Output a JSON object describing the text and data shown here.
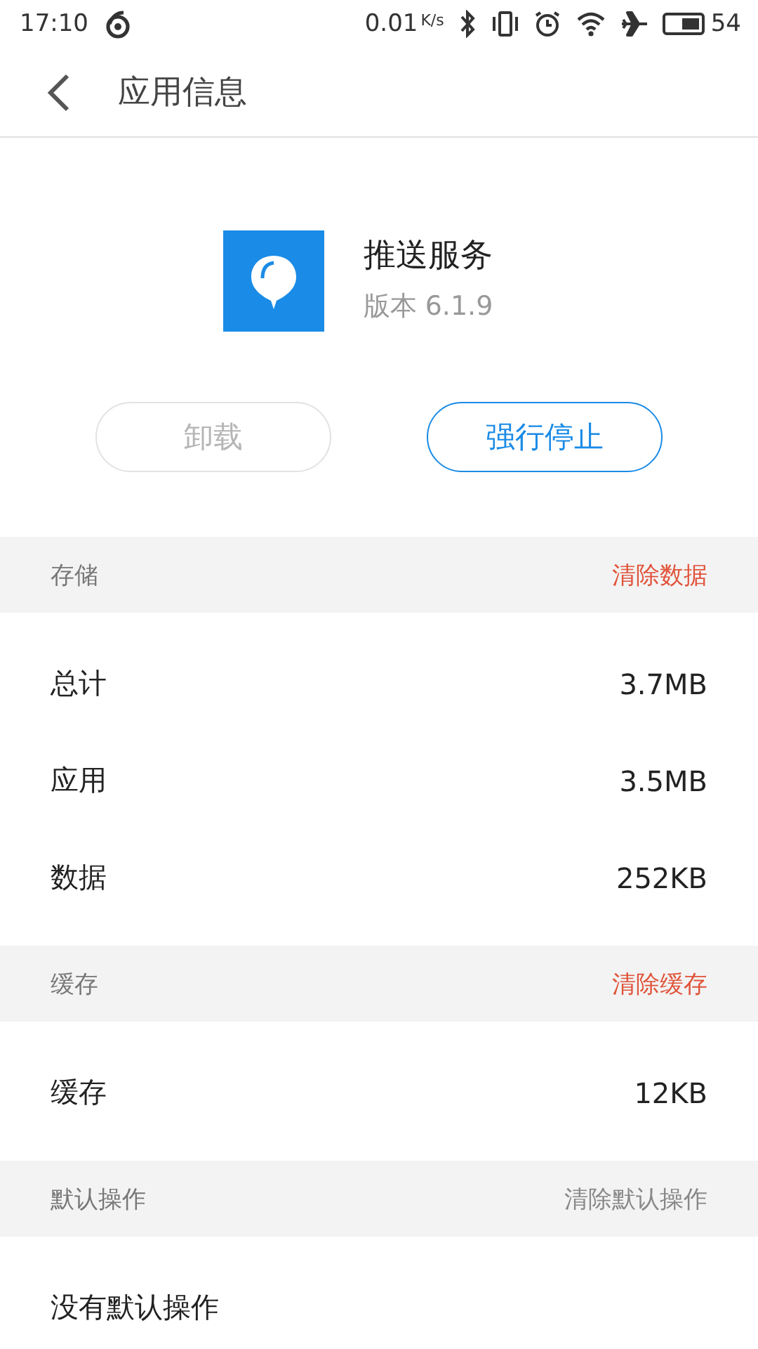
{
  "status_bar": {
    "time": "17:10",
    "speed": "0.01",
    "speed_unit": "K/s",
    "battery": "54"
  },
  "toolbar": {
    "title": "应用信息"
  },
  "app": {
    "name": "推送服务",
    "version": "版本 6.1.9"
  },
  "buttons": [
    {
      "label": "卸载",
      "disabled": true
    },
    {
      "label": "强行停止",
      "disabled": false
    }
  ],
  "sections": [
    {
      "title": "存储",
      "action": {
        "label": "清除数据",
        "disabled": false
      },
      "rows": [
        {
          "label": "总计",
          "value": "3.7MB"
        },
        {
          "label": "应用",
          "value": "3.5MB"
        },
        {
          "label": "数据",
          "value": "252KB"
        }
      ]
    },
    {
      "title": "缓存",
      "action": {
        "label": "清除缓存",
        "disabled": false
      },
      "rows": [
        {
          "label": "缓存",
          "value": "12KB"
        }
      ]
    },
    {
      "title": "默认操作",
      "action": {
        "label": "清除默认操作",
        "disabled": true
      },
      "rows": [
        {
          "label": "没有默认操作"
        }
      ]
    }
  ]
}
